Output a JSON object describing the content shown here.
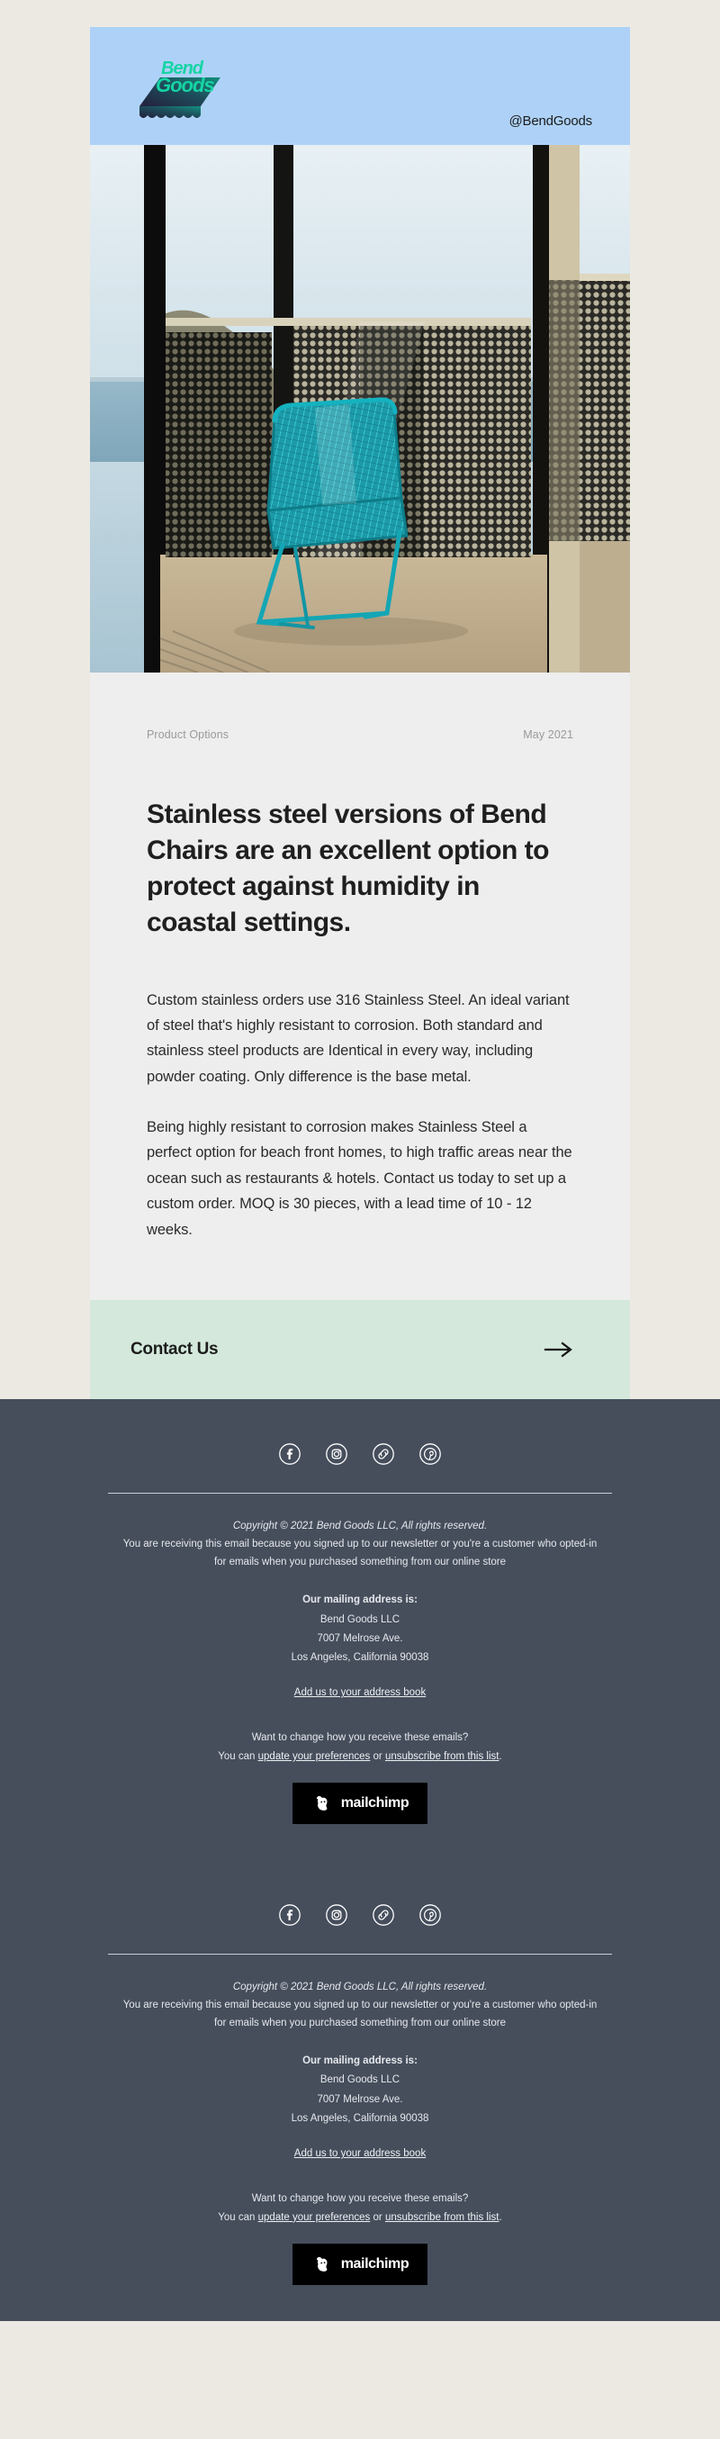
{
  "header": {
    "logo_line1": "Bend",
    "logo_line2": "Goods",
    "logo_name": "bend-goods-logo",
    "handle": "@BendGoods",
    "bg_color": "#aed2f7",
    "logo_color": "#16d4a4"
  },
  "hero": {
    "alt": "Teal wire Bend chair on a balcony overlooking the ocean"
  },
  "article": {
    "category": "Product Options",
    "date": "May 2021",
    "headline": "Stainless steel versions of Bend Chairs are an excellent option to protect against humidity in coastal settings.",
    "paragraphs": [
      "Custom stainless orders use 316 Stainless Steel. An ideal variant of steel that's highly resistant to corrosion. Both standard and stainless steel products are Identical in every way, including powder coating. Only difference is the base metal.",
      "Being highly resistant to corrosion makes Stainless Steel a perfect option for beach front homes, to high traffic areas near the ocean such as restaurants & hotels. Contact us today to set up a custom order. MOQ is 30 pieces, with a lead time of 10 - 12 weeks."
    ],
    "bg_color": "#eeeeee"
  },
  "cta": {
    "label": "Contact Us",
    "arrow": "→",
    "bg_color": "#d4e9dc"
  },
  "footer": {
    "bg_color": "#464e5c",
    "socials": [
      {
        "name": "facebook-icon",
        "label": "Facebook"
      },
      {
        "name": "instagram-icon",
        "label": "Instagram"
      },
      {
        "name": "website-link-icon",
        "label": "Website"
      },
      {
        "name": "pinterest-icon",
        "label": "Pinterest"
      }
    ],
    "copyright": "Copyright © 2021 Bend Goods LLC, All rights reserved.",
    "reason_line1": "You are receiving this email because you signed up to our newsletter or you're a customer who opted-in",
    "reason_line2": "for emails when you purchased something from our online store",
    "address_heading": "Our mailing address is:",
    "address_line1": "Bend Goods LLC",
    "address_line2": "7007 Melrose Ave.",
    "address_line3": "Los Angeles, California 90038",
    "address_book_link": "Add us to your address book",
    "prefs_question": "Want to change how you receive these emails?",
    "prefs_prefix": "You can ",
    "prefs_link_update": "update your preferences",
    "prefs_or": " or ",
    "prefs_link_unsub": "unsubscribe from this list",
    "prefs_suffix": ".",
    "mailchimp_label": "mailchimp"
  }
}
